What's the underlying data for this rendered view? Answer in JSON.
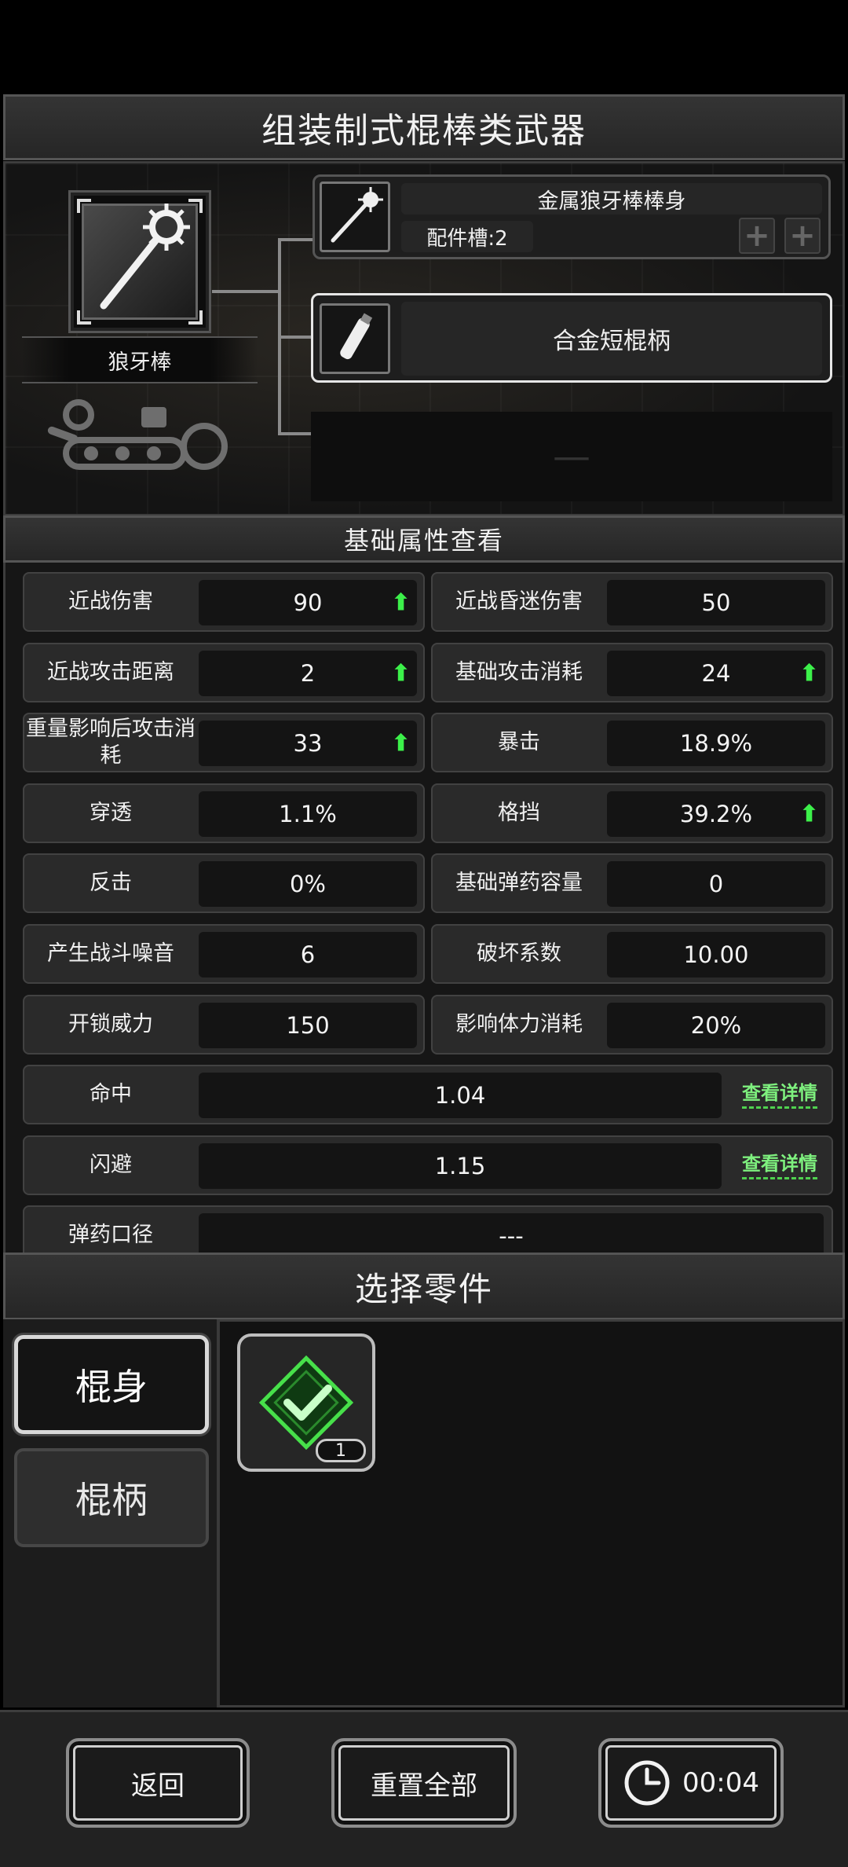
{
  "title": "组装制式棍棒类武器",
  "weapon": {
    "name": "狼牙棒",
    "parts": [
      {
        "name": "金属狼牙棒棒身",
        "slots_label": "配件槽:2"
      },
      {
        "name": "合金短棍柄"
      },
      {
        "name": "—"
      }
    ]
  },
  "stats_title": "基础属性查看",
  "stats": [
    {
      "label": "近战伤害",
      "value": "90",
      "up": true
    },
    {
      "label": "近战昏迷伤害",
      "value": "50",
      "up": false
    },
    {
      "label": "近战攻击距离",
      "value": "2",
      "up": true
    },
    {
      "label": "基础攻击消耗",
      "value": "24",
      "up": true
    },
    {
      "label": "重量影响后攻击消耗",
      "value": "33",
      "up": true
    },
    {
      "label": "暴击",
      "value": "18.9%",
      "up": false
    },
    {
      "label": "穿透",
      "value": "1.1%",
      "up": false
    },
    {
      "label": "格挡",
      "value": "39.2%",
      "up": true
    },
    {
      "label": "反击",
      "value": "0%",
      "up": false
    },
    {
      "label": "基础弹药容量",
      "value": "0",
      "up": false
    },
    {
      "label": "产生战斗噪音",
      "value": "6",
      "up": false
    },
    {
      "label": "破坏系数",
      "value": "10.00",
      "up": false
    },
    {
      "label": "开锁威力",
      "value": "150",
      "up": false
    },
    {
      "label": "影响体力消耗",
      "value": "20%",
      "up": false
    }
  ],
  "wide_stats": [
    {
      "label": "命中",
      "value": "1.04",
      "link": "查看详情"
    },
    {
      "label": "闪避",
      "value": "1.15",
      "link": "查看详情"
    },
    {
      "label": "弹药口径",
      "value": "---",
      "link": ""
    }
  ],
  "up_arrow": "⬆",
  "picker": {
    "title": "选择零件",
    "categories": [
      "棍身",
      "棍柄"
    ],
    "item_count": "1"
  },
  "footer": {
    "back": "返回",
    "reset": "重置全部",
    "timer": "00:04"
  },
  "colors": {
    "accent_green": "#3cf04a",
    "link_green": "#7ef07e"
  }
}
